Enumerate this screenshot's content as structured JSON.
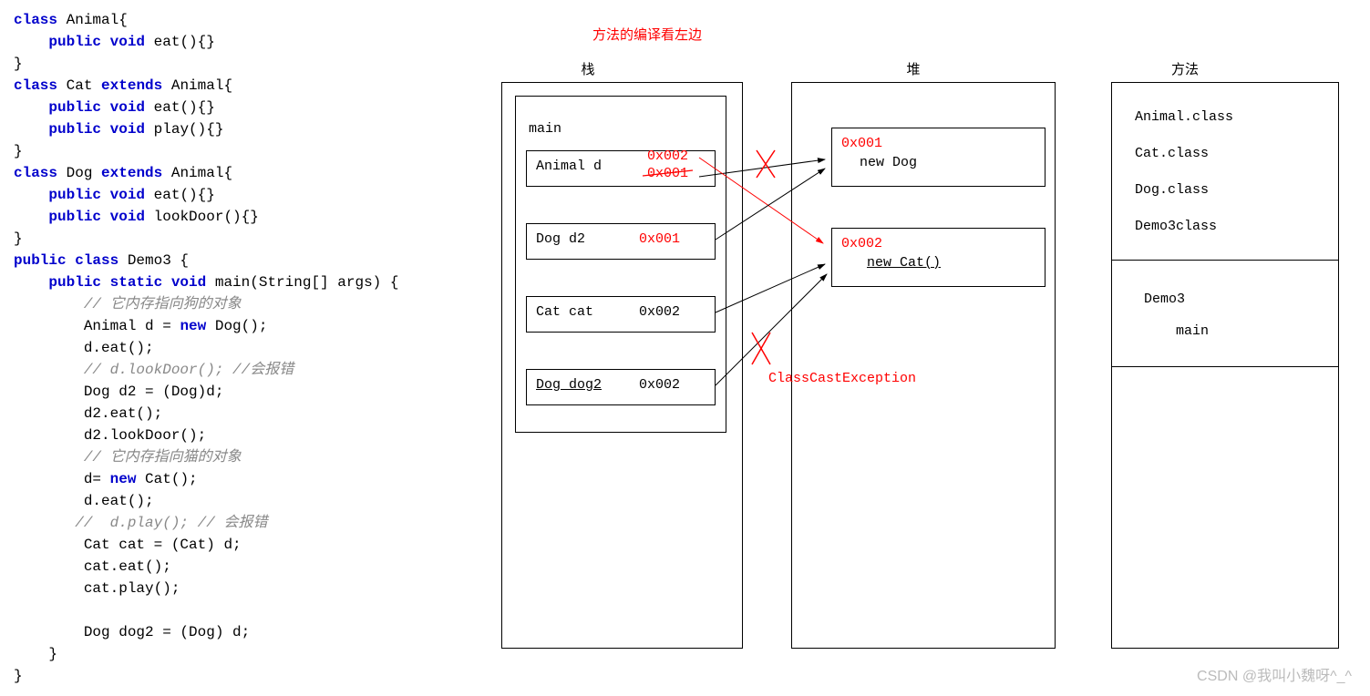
{
  "code": {
    "l1a": "class",
    "l1b": " Animal{",
    "l2a": "    public void",
    "l2b": " eat(){}",
    "l3": "}",
    "l4a": "class",
    "l4b": " Cat ",
    "l4c": "extends",
    "l4d": " Animal{",
    "l5a": "    public void",
    "l5b": " eat(){}",
    "l6a": "    public void",
    "l6b": " play(){}",
    "l7": "}",
    "l8a": "class",
    "l8b": " Dog ",
    "l8c": "extends",
    "l8d": " Animal{",
    "l9a": "    public void",
    "l9b": " eat(){}",
    "l10a": "    public void",
    "l10b": " lookDoor(){}",
    "l11": "}",
    "l12a": "public class",
    "l12b": " Demo3 {",
    "l13a": "    public static void",
    "l13b": " main(String[] args) {",
    "l14": "        // 它内存指向狗的对象",
    "l15a": "        Animal d = ",
    "l15b": "new",
    "l15c": " Dog();",
    "l16": "        d.eat();",
    "l17": "        // d.lookDoor(); //会报错",
    "l18": "        Dog d2 = (Dog)d;",
    "l19": "        d2.eat();",
    "l20": "        d2.lookDoor();",
    "l21": "        // 它内存指向猫的对象",
    "l22a": "        d= ",
    "l22b": "new",
    "l22c": " Cat();",
    "l23": "        d.eat();",
    "l24": "       //  d.play(); // 会报错",
    "l25": "        Cat cat = (Cat) d;",
    "l26": "        cat.eat();",
    "l27": "        cat.play();",
    "l28": "",
    "l29": "        Dog dog2 = (Dog) d;",
    "l30": "    }",
    "l31": "}"
  },
  "diagram": {
    "note_top": "方法的编译看左边",
    "col_stack": "栈",
    "col_heap": "堆",
    "col_method": "方法",
    "main_label": "main",
    "stack": {
      "r1_var": "Animal d",
      "r1_addr1": "0x002",
      "r1_addr2": "0x001",
      "r2_var": "Dog d2",
      "r2_addr": "0x001",
      "r3_var": "Cat cat",
      "r3_addr": "0x002",
      "r4_var": "Dog dog2",
      "r4_addr": "0x002"
    },
    "heap": {
      "h1_addr": "0x001",
      "h1_val": "new Dog",
      "h2_addr": "0x002",
      "h2_val": "new Cat()"
    },
    "exception": "ClassCastException",
    "method": {
      "c1": "Animal.class",
      "c2": "Cat.class",
      "c3": "Dog.class",
      "c4": "Demo3class",
      "t1": "Demo3",
      "t2": "main"
    }
  },
  "watermark": "CSDN @我叫小魏呀^_^"
}
